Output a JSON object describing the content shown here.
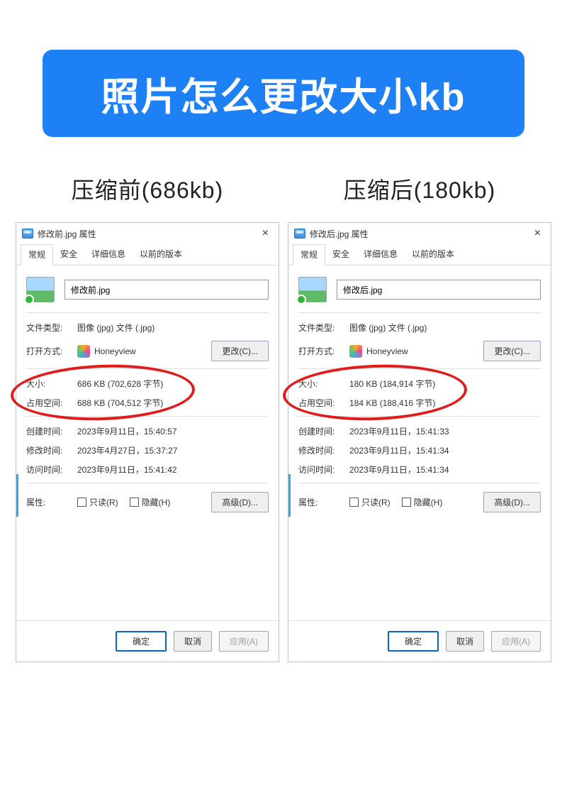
{
  "banner": "照片怎么更改大小kb",
  "left": {
    "col_title": "压缩前(686kb)",
    "win_title": "修改前.jpg 属性",
    "filename": "修改前.jpg",
    "filetype": "图像 (jpg) 文件 (.jpg)",
    "openwith": "Honeyview",
    "size": "686 KB (702,628 字节)",
    "sizeondisk": "688 KB (704,512 字节)",
    "created": "2023年9月11日，15:40:57",
    "modified": "2023年4月27日，15:37:27",
    "accessed": "2023年9月11日，15:41:42"
  },
  "right": {
    "col_title": "压缩后(180kb)",
    "win_title": "修改后.jpg 属性",
    "filename": "修改后.jpg",
    "filetype": "图像 (jpg) 文件 (.jpg)",
    "openwith": "Honeyview",
    "size": "180 KB (184,914 字节)",
    "sizeondisk": "184 KB (188,416 字节)",
    "created": "2023年9月11日，15:41:33",
    "modified": "2023年9月11日，15:41:34",
    "accessed": "2023年9月11日，15:41:34"
  },
  "labels": {
    "tab_general": "常规",
    "tab_security": "安全",
    "tab_details": "详细信息",
    "tab_prev": "以前的版本",
    "filetype": "文件类型:",
    "openwith": "打开方式:",
    "size": "大小:",
    "sizeondisk": "占用空间:",
    "created": "创建时间:",
    "modified": "修改时间:",
    "accessed": "访问时间:",
    "attrs": "属性:",
    "readonly": "只读(R)",
    "hidden": "隐藏(H)",
    "change": "更改(C)...",
    "advanced": "高级(D)...",
    "ok": "确定",
    "cancel": "取消",
    "apply": "应用(A)"
  }
}
